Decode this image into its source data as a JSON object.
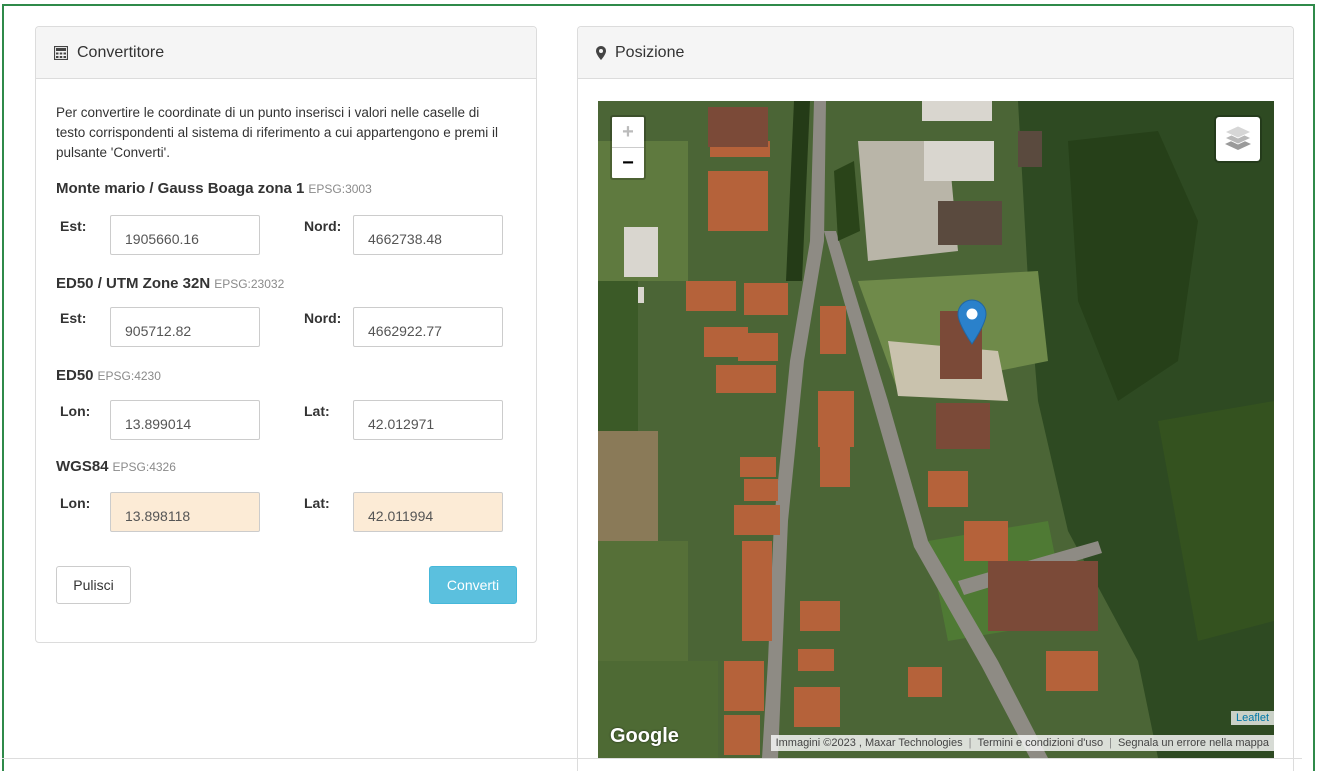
{
  "converter": {
    "title": "Convertitore",
    "intro": "Per convertire le coordinate di un punto inserisci i valori nelle caselle di testo corrispondenti al sistema di riferimento a cui appartengono e premi il pulsante 'Converti'.",
    "systems": [
      {
        "name": "Monte mario / Gauss Boaga zona 1",
        "epsg": "EPSG:3003",
        "label1": "Est:",
        "value1": "1905660.16",
        "label2": "Nord:",
        "value2": "4662738.48",
        "readonly": false
      },
      {
        "name": "ED50 / UTM Zone 32N",
        "epsg": "EPSG:23032",
        "label1": "Est:",
        "value1": "905712.82",
        "label2": "Nord:",
        "value2": "4662922.77",
        "readonly": false
      },
      {
        "name": "ED50",
        "epsg": "EPSG:4230",
        "label1": "Lon:",
        "value1": "13.899014",
        "label2": "Lat:",
        "value2": "42.012971",
        "readonly": false
      },
      {
        "name": "WGS84",
        "epsg": "EPSG:4326",
        "label1": "Lon:",
        "value1": "13.898118",
        "label2": "Lat:",
        "value2": "42.011994",
        "readonly": true
      }
    ],
    "clear_label": "Pulisci",
    "convert_label": "Converti"
  },
  "position": {
    "title": "Posizione",
    "zoom_in": "+",
    "zoom_out": "−",
    "leaflet_attribution": "Leaflet",
    "google_logo": "Google",
    "google_attribution": [
      "Immagini ©2023 , Maxar Technologies",
      "Termini e condizioni d'uso",
      "Segnala un errore nella mappa"
    ]
  },
  "colors": {
    "frame": "#2f8a4a",
    "convert_button": "#5bc0de",
    "readonly_field": "#fcebd6",
    "marker": "#2a81cb"
  }
}
